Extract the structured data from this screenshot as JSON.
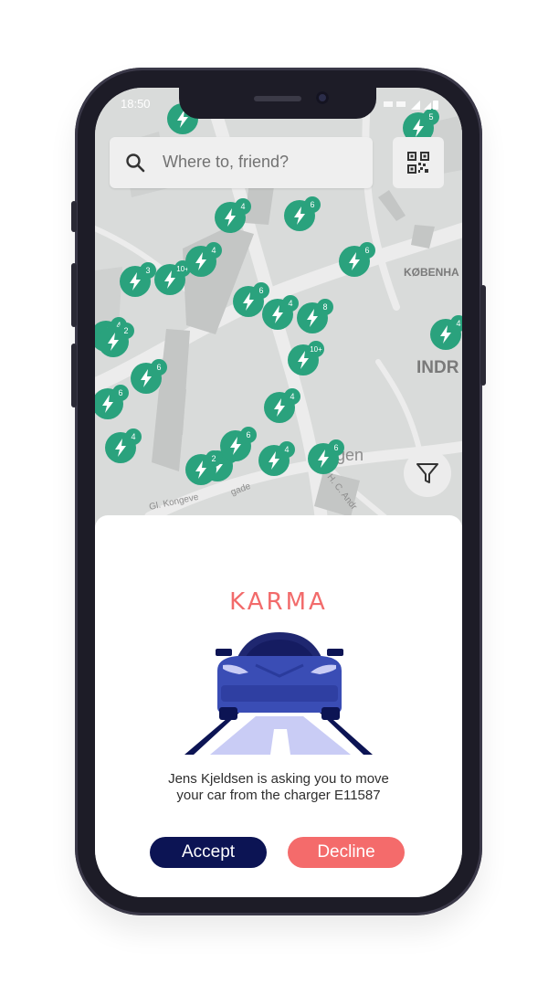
{
  "status_bar": {
    "time": "18:50"
  },
  "search": {
    "placeholder": "Where to, friend?"
  },
  "map": {
    "districts": [
      "KØBENHA",
      "INDR"
    ],
    "streets": [
      "Gl. Kongeve",
      "gade",
      "H. C. Andr",
      "gen"
    ],
    "pin_color": "#2aa27d",
    "markers": [
      "4",
      "6",
      "6",
      "10+",
      "4",
      "6",
      "4",
      "8",
      "10+",
      "4",
      "3",
      "4",
      "6",
      "6",
      "4",
      "4",
      "2",
      "6",
      "4",
      "6",
      "4",
      "5",
      "4",
      "2"
    ]
  },
  "karma_popup": {
    "brand": "KARMA",
    "message_line1": "Jens Kjeldsen is asking you to move",
    "message_line2": "your car from the charger E11587",
    "accept_label": "Accept",
    "decline_label": "Decline",
    "accent_dark": "#0c1454",
    "accent_coral": "#f46b6b"
  }
}
